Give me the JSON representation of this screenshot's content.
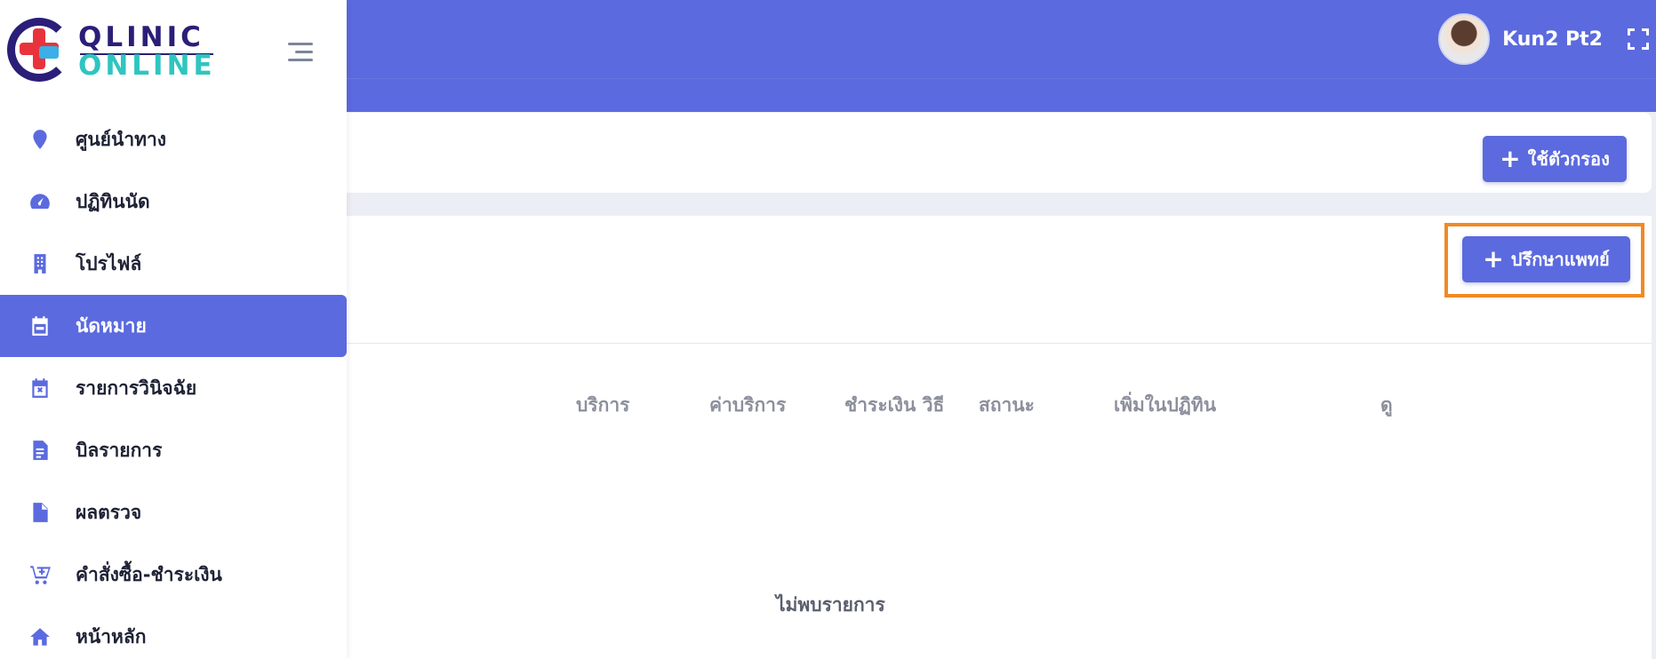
{
  "header": {
    "user_name": "Kun2 Pt2"
  },
  "brand": {
    "logo_line1": "QLINIC",
    "logo_line2": "ONLINE",
    "accent_color": "#5b6ade",
    "highlight_color": "#f08a24"
  },
  "sidebar": {
    "items": [
      {
        "label": "ศูนย์นำทาง",
        "icon": "map-pin-icon",
        "active": false
      },
      {
        "label": "ปฏิทินนัด",
        "icon": "speedometer-icon",
        "active": false
      },
      {
        "label": "โปรไฟล์",
        "icon": "building-icon",
        "active": false
      },
      {
        "label": "นัดหมาย",
        "icon": "calendar-icon",
        "active": true
      },
      {
        "label": "รายการวินิจฉัย",
        "icon": "calendar-x-icon",
        "active": false
      },
      {
        "label": "บิลรายการ",
        "icon": "invoice-icon",
        "active": false
      },
      {
        "label": "ผลตรวจ",
        "icon": "file-icon",
        "active": false
      },
      {
        "label": "คำสั่งซื้อ-ชำระเงิน",
        "icon": "cart-plus-icon",
        "active": false
      },
      {
        "label": "หน้าหลัก",
        "icon": "home-icon",
        "active": false
      }
    ]
  },
  "filter": {
    "button_label": "ใช้ตัวกรอง"
  },
  "list": {
    "consult_button_label": "ปรึกษาแพทย์",
    "columns": [
      "บริการ",
      "ค่าบริการ",
      "ชำระเงิน วิธี",
      "สถานะ",
      "เพิ่มในปฏิทิน",
      "ดู"
    ],
    "empty_message": "ไม่พบรายการ"
  }
}
